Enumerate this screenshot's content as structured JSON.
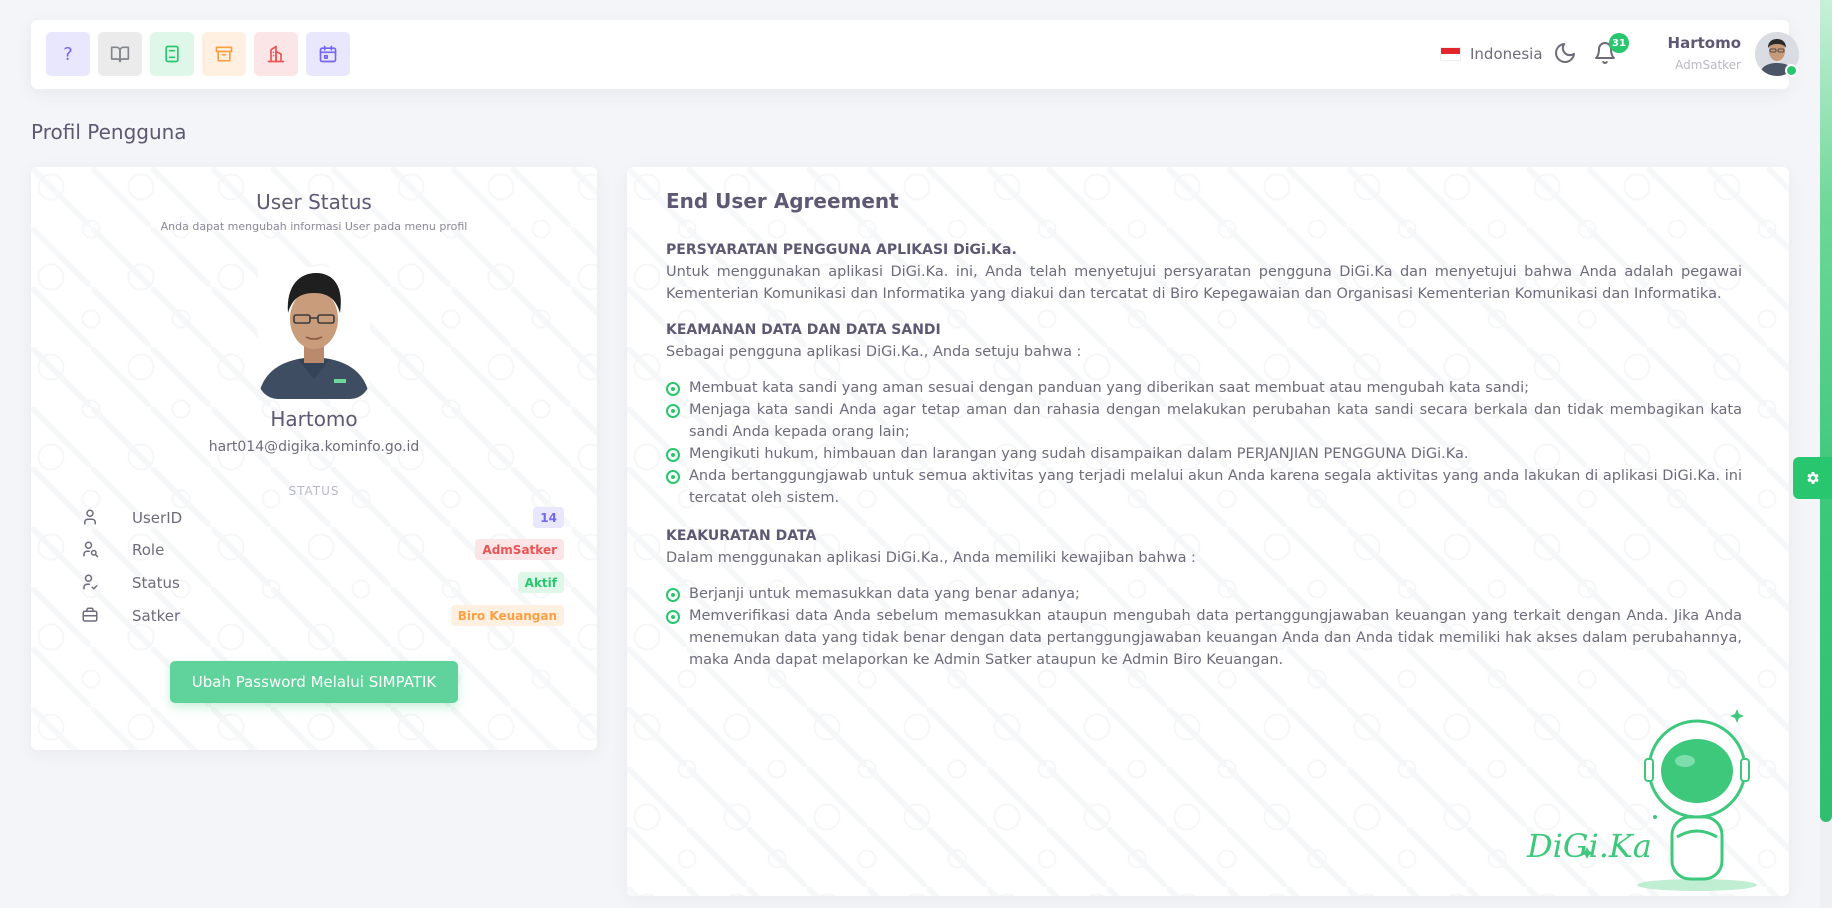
{
  "navbar": {
    "shortcuts": [
      {
        "name": "help",
        "icon": "help-icon",
        "glyph": "?",
        "bg": "#e9e7fd",
        "color": "#7367f0"
      },
      {
        "name": "book",
        "icon": "book-icon",
        "bg": "#ebebeb",
        "color": "#82868b"
      },
      {
        "name": "notebook",
        "icon": "notebook-icon",
        "bg": "#dff7e9",
        "color": "#28c76f"
      },
      {
        "name": "archive",
        "icon": "archive-icon",
        "bg": "#fff0e1",
        "color": "#ff9f43"
      },
      {
        "name": "building",
        "icon": "building-icon",
        "bg": "#fce5e6",
        "color": "#ea5455"
      },
      {
        "name": "calendar",
        "icon": "calendar-icon",
        "bg": "#e9e7fd",
        "color": "#7367f0"
      }
    ],
    "language": "Indonesia",
    "notification_count": "31",
    "user_name": "Hartomo",
    "user_role": "AdmSatker"
  },
  "page_title": "Profil Pengguna",
  "user_status": {
    "title": "User Status",
    "subtitle": "Anda dapat mengubah informasi User pada menu profil",
    "name": "Hartomo",
    "email": "hart014@digika.kominfo.go.id",
    "status_heading": "STATUS",
    "rows": [
      {
        "label": "UserID",
        "value": "14"
      },
      {
        "label": "Role",
        "value": "AdmSatker"
      },
      {
        "label": "Status",
        "value": "Aktif"
      },
      {
        "label": "Satker",
        "value": "Biro Keuangan"
      }
    ],
    "button_label": "Ubah Password Melalui SIMPATIK"
  },
  "agreement": {
    "title": "End User Agreement",
    "s1_heading": "PERSYARATAN PENGGUNA APLIKASI DiGi.Ka.",
    "s1_text": "Untuk menggunakan aplikasi DiGi.Ka. ini, Anda telah menyetujui persyaratan pengguna DiGi.Ka dan menyetujui bahwa Anda adalah pegawai Kementerian Komunikasi dan Informatika yang diakui dan tercatat di Biro Kepegawaian dan Organisasi Kementerian Komunikasi dan Informatika.",
    "s2_heading": "KEAMANAN DATA DAN DATA SANDI",
    "s2_intro": "Sebagai pengguna aplikasi DiGi.Ka., Anda setuju bahwa :",
    "s2_items": [
      "Membuat kata sandi yang aman sesuai dengan panduan yang diberikan saat membuat atau mengubah kata sandi;",
      "Menjaga kata sandi Anda agar tetap aman dan rahasia dengan melakukan perubahan kata sandi secara berkala dan tidak membagikan kata sandi Anda kepada orang lain;",
      "Mengikuti hukum, himbauan dan larangan yang sudah disampaikan dalam PERJANJIAN PENGGUNA DiGi.Ka.",
      "Anda bertanggungjawab untuk semua aktivitas yang terjadi melalui akun Anda karena segala aktivitas yang anda lakukan di aplikasi DiGi.Ka. ini tercatat oleh sistem."
    ],
    "s3_heading": "KEAKURATAN DATA",
    "s3_intro": "Dalam menggunakan aplikasi DiGi.Ka., Anda memiliki kewajiban bahwa :",
    "s3_items": [
      "Berjanji untuk memasukkan data yang benar adanya;",
      "Memverifikasi data Anda sebelum memasukkan ataupun mengubah data pertanggungjawaban keuangan yang terkait dengan Anda. Jika Anda menemukan data yang tidak benar dengan data pertanggungjawaban keuangan Anda dan Anda tidak memiliki hak akses dalam perubahannya, maka Anda dapat melaporkan ke Admin Satker ataupun ke Admin Biro Keuangan."
    ],
    "brand": "DiGi.Ka"
  },
  "colors": {
    "accent_green": "#28c76f",
    "button_green": "#5fd39b",
    "text_heading": "#5e5873",
    "text_body": "#6e6b7b"
  }
}
